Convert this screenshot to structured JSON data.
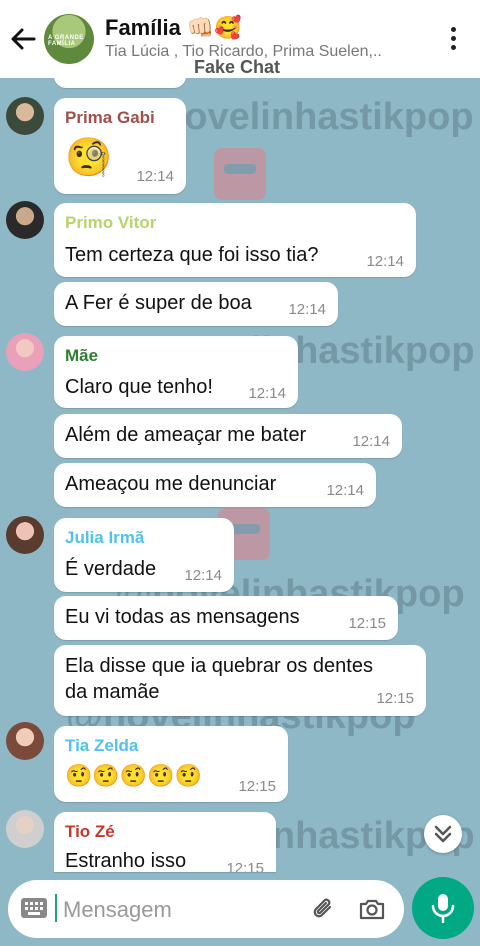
{
  "header": {
    "title": "Família 👊🏻🥰",
    "members": "Tia Lúcia , Tio Ricardo, Prima Suelen,..",
    "avatar_text": "A GRANDE FAMÍLIA"
  },
  "watermark": {
    "top_label": "Fake Chat",
    "handle": "@novelinhastikpop"
  },
  "messages": [
    {
      "sender": "Prima Gabi",
      "sender_color": "#a0504a",
      "text": "🧐",
      "time": "12:14"
    },
    {
      "sender": "Primo Vitor",
      "sender_color": "#b7d36a",
      "text": "Tem certeza que foi isso tia?",
      "time": "12:14"
    },
    {
      "text": "A Fer é super de boa",
      "time": "12:14"
    },
    {
      "sender": "Mãe",
      "sender_color": "#2e7d32",
      "text": "Claro que tenho!",
      "time": "12:14"
    },
    {
      "text": "Além de ameaçar me bater",
      "time": "12:14"
    },
    {
      "text": "Ameaçou me denunciar",
      "time": "12:14"
    },
    {
      "sender": "Julia Irmã",
      "sender_color": "#4fc3e8",
      "text": "É verdade",
      "time": "12:14"
    },
    {
      "text": "Eu vi todas as mensagens",
      "time": "12:15"
    },
    {
      "text_line1": "Ela disse que ia quebrar os dentes",
      "text_line2": "da mamãe",
      "time": "12:15"
    },
    {
      "sender": "Tia Zelda",
      "sender_color": "#4fc3e8",
      "text": "🤨🤨🤨🤨🤨",
      "time": "12:15"
    },
    {
      "sender": "Tio Zé",
      "sender_color": "#c0392b",
      "text": "Estranho isso",
      "time": "12:15"
    }
  ],
  "input": {
    "placeholder": "Mensagem"
  },
  "colors": {
    "background": "#8fb8c6",
    "accent": "#00a884"
  }
}
